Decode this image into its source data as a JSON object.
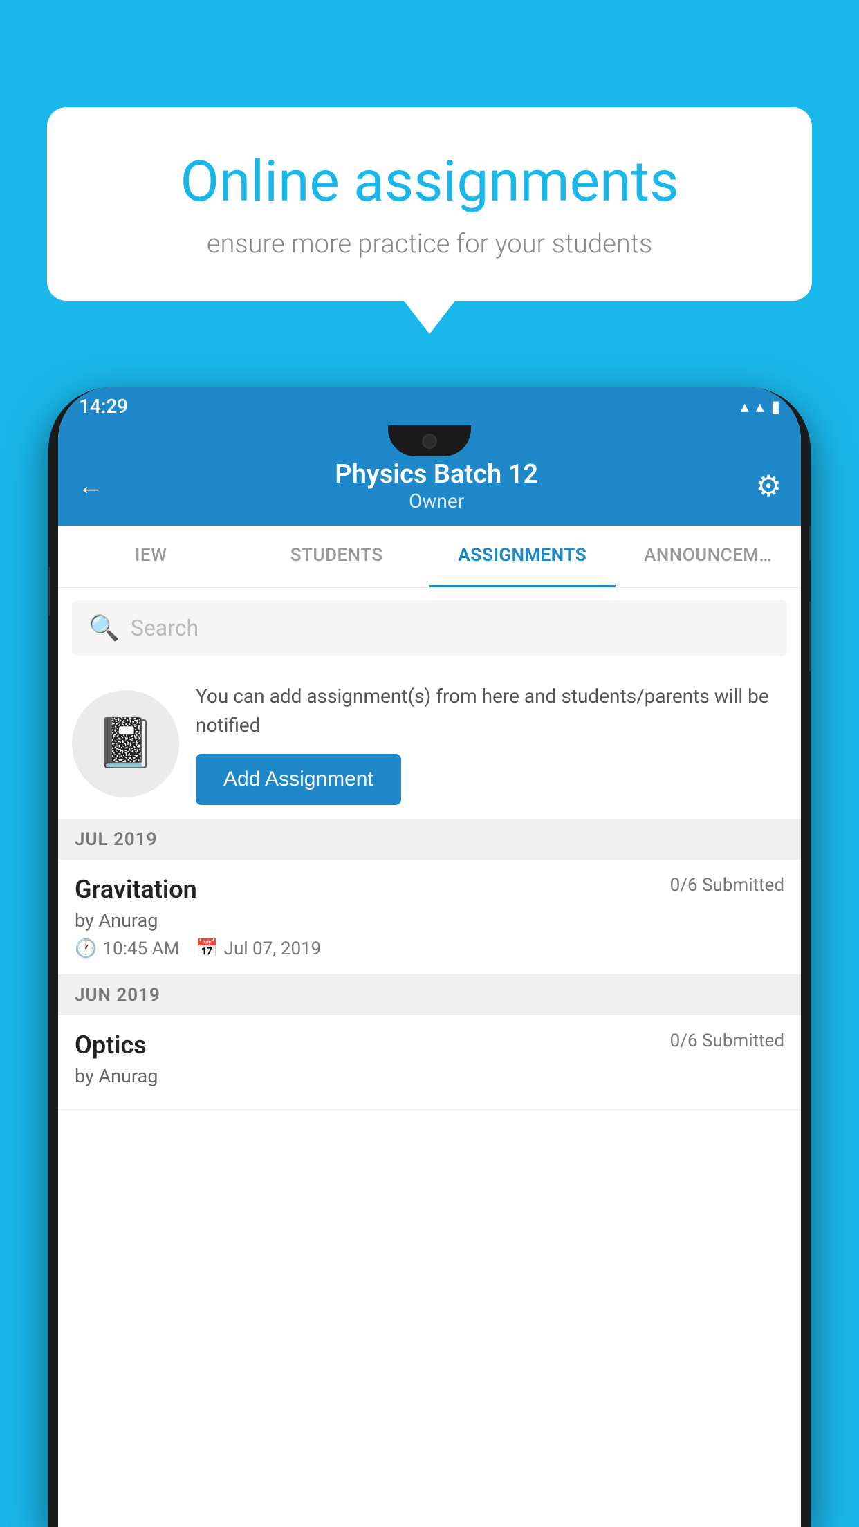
{
  "background_color": "#1ab7ea",
  "speech_bubble": {
    "title": "Online assignments",
    "subtitle": "ensure more practice for your students"
  },
  "phone": {
    "status_bar": {
      "time": "14:29",
      "wifi": "▾",
      "signal": "▲",
      "battery": "▮"
    },
    "app_bar": {
      "title": "Physics Batch 12",
      "subtitle": "Owner",
      "back_label": "←",
      "settings_label": "⚙"
    },
    "tabs": [
      {
        "label": "IEW",
        "active": false
      },
      {
        "label": "STUDENTS",
        "active": false
      },
      {
        "label": "ASSIGNMENTS",
        "active": true
      },
      {
        "label": "ANNOUNCEM…",
        "active": false
      }
    ],
    "search": {
      "placeholder": "Search"
    },
    "promo": {
      "description": "You can add assignment(s) from here and students/parents will be notified",
      "button_label": "Add Assignment"
    },
    "sections": [
      {
        "header": "JUL 2019",
        "assignments": [
          {
            "name": "Gravitation",
            "submitted": "0/6 Submitted",
            "by": "by Anurag",
            "time": "10:45 AM",
            "date": "Jul 07, 2019"
          }
        ]
      },
      {
        "header": "JUN 2019",
        "assignments": [
          {
            "name": "Optics",
            "submitted": "0/6 Submitted",
            "by": "by Anurag",
            "time": "",
            "date": ""
          }
        ]
      }
    ]
  }
}
